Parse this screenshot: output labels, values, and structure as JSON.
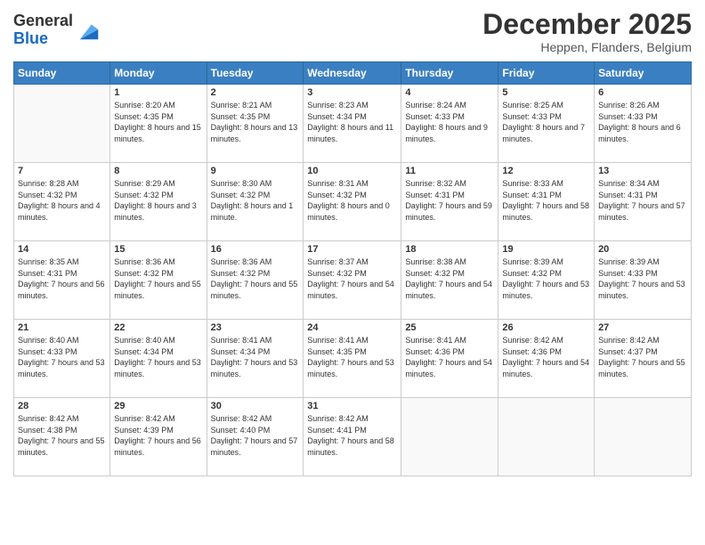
{
  "logo": {
    "general": "General",
    "blue": "Blue"
  },
  "header": {
    "month": "December 2025",
    "location": "Heppen, Flanders, Belgium"
  },
  "weekdays": [
    "Sunday",
    "Monday",
    "Tuesday",
    "Wednesday",
    "Thursday",
    "Friday",
    "Saturday"
  ],
  "weeks": [
    [
      {
        "day": null
      },
      {
        "day": 1,
        "sunrise": "8:20 AM",
        "sunset": "4:35 PM",
        "daylight": "8 hours and 15 minutes."
      },
      {
        "day": 2,
        "sunrise": "8:21 AM",
        "sunset": "4:35 PM",
        "daylight": "8 hours and 13 minutes."
      },
      {
        "day": 3,
        "sunrise": "8:23 AM",
        "sunset": "4:34 PM",
        "daylight": "8 hours and 11 minutes."
      },
      {
        "day": 4,
        "sunrise": "8:24 AM",
        "sunset": "4:33 PM",
        "daylight": "8 hours and 9 minutes."
      },
      {
        "day": 5,
        "sunrise": "8:25 AM",
        "sunset": "4:33 PM",
        "daylight": "8 hours and 7 minutes."
      },
      {
        "day": 6,
        "sunrise": "8:26 AM",
        "sunset": "4:33 PM",
        "daylight": "8 hours and 6 minutes."
      }
    ],
    [
      {
        "day": 7,
        "sunrise": "8:28 AM",
        "sunset": "4:32 PM",
        "daylight": "8 hours and 4 minutes."
      },
      {
        "day": 8,
        "sunrise": "8:29 AM",
        "sunset": "4:32 PM",
        "daylight": "8 hours and 3 minutes."
      },
      {
        "day": 9,
        "sunrise": "8:30 AM",
        "sunset": "4:32 PM",
        "daylight": "8 hours and 1 minute."
      },
      {
        "day": 10,
        "sunrise": "8:31 AM",
        "sunset": "4:32 PM",
        "daylight": "8 hours and 0 minutes."
      },
      {
        "day": 11,
        "sunrise": "8:32 AM",
        "sunset": "4:31 PM",
        "daylight": "7 hours and 59 minutes."
      },
      {
        "day": 12,
        "sunrise": "8:33 AM",
        "sunset": "4:31 PM",
        "daylight": "7 hours and 58 minutes."
      },
      {
        "day": 13,
        "sunrise": "8:34 AM",
        "sunset": "4:31 PM",
        "daylight": "7 hours and 57 minutes."
      }
    ],
    [
      {
        "day": 14,
        "sunrise": "8:35 AM",
        "sunset": "4:31 PM",
        "daylight": "7 hours and 56 minutes."
      },
      {
        "day": 15,
        "sunrise": "8:36 AM",
        "sunset": "4:32 PM",
        "daylight": "7 hours and 55 minutes."
      },
      {
        "day": 16,
        "sunrise": "8:36 AM",
        "sunset": "4:32 PM",
        "daylight": "7 hours and 55 minutes."
      },
      {
        "day": 17,
        "sunrise": "8:37 AM",
        "sunset": "4:32 PM",
        "daylight": "7 hours and 54 minutes."
      },
      {
        "day": 18,
        "sunrise": "8:38 AM",
        "sunset": "4:32 PM",
        "daylight": "7 hours and 54 minutes."
      },
      {
        "day": 19,
        "sunrise": "8:39 AM",
        "sunset": "4:32 PM",
        "daylight": "7 hours and 53 minutes."
      },
      {
        "day": 20,
        "sunrise": "8:39 AM",
        "sunset": "4:33 PM",
        "daylight": "7 hours and 53 minutes."
      }
    ],
    [
      {
        "day": 21,
        "sunrise": "8:40 AM",
        "sunset": "4:33 PM",
        "daylight": "7 hours and 53 minutes."
      },
      {
        "day": 22,
        "sunrise": "8:40 AM",
        "sunset": "4:34 PM",
        "daylight": "7 hours and 53 minutes."
      },
      {
        "day": 23,
        "sunrise": "8:41 AM",
        "sunset": "4:34 PM",
        "daylight": "7 hours and 53 minutes."
      },
      {
        "day": 24,
        "sunrise": "8:41 AM",
        "sunset": "4:35 PM",
        "daylight": "7 hours and 53 minutes."
      },
      {
        "day": 25,
        "sunrise": "8:41 AM",
        "sunset": "4:36 PM",
        "daylight": "7 hours and 54 minutes."
      },
      {
        "day": 26,
        "sunrise": "8:42 AM",
        "sunset": "4:36 PM",
        "daylight": "7 hours and 54 minutes."
      },
      {
        "day": 27,
        "sunrise": "8:42 AM",
        "sunset": "4:37 PM",
        "daylight": "7 hours and 55 minutes."
      }
    ],
    [
      {
        "day": 28,
        "sunrise": "8:42 AM",
        "sunset": "4:38 PM",
        "daylight": "7 hours and 55 minutes."
      },
      {
        "day": 29,
        "sunrise": "8:42 AM",
        "sunset": "4:39 PM",
        "daylight": "7 hours and 56 minutes."
      },
      {
        "day": 30,
        "sunrise": "8:42 AM",
        "sunset": "4:40 PM",
        "daylight": "7 hours and 57 minutes."
      },
      {
        "day": 31,
        "sunrise": "8:42 AM",
        "sunset": "4:41 PM",
        "daylight": "7 hours and 58 minutes."
      },
      {
        "day": null
      },
      {
        "day": null
      },
      {
        "day": null
      }
    ]
  ]
}
